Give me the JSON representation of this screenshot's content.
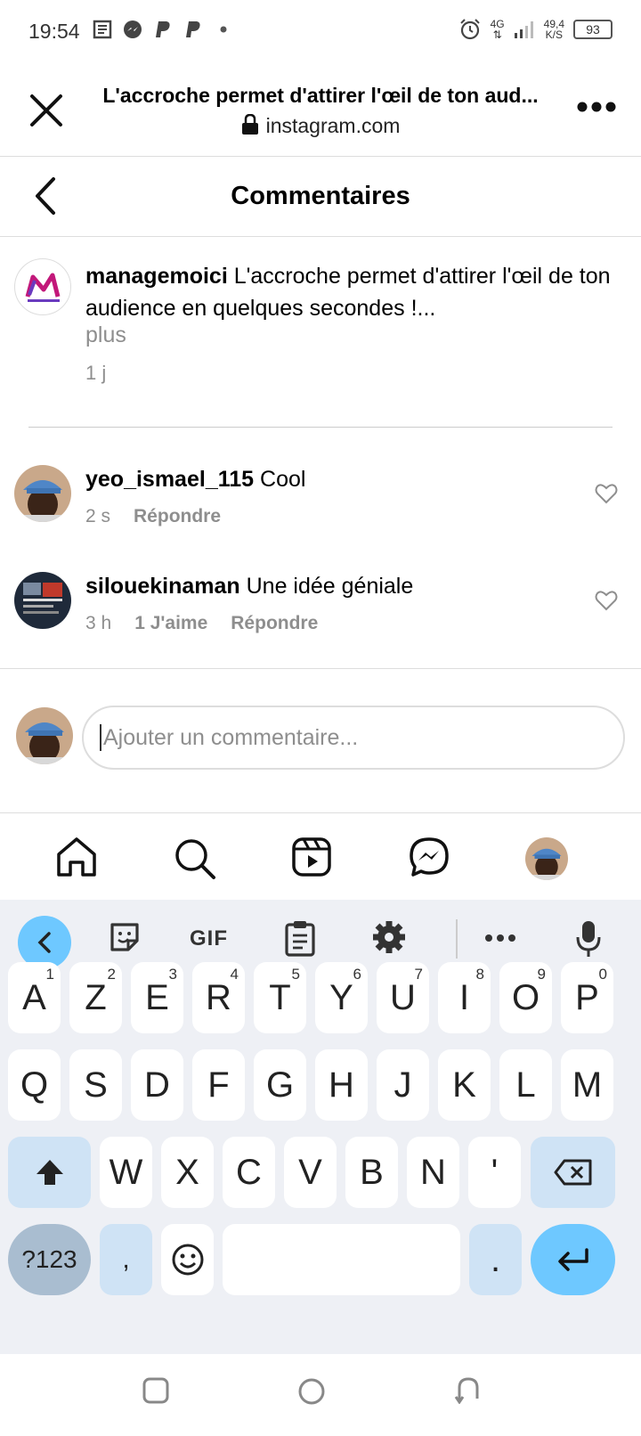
{
  "status_bar": {
    "time": "19:54",
    "network": "4G",
    "speed_value": "49,4",
    "speed_unit": "K/S",
    "battery": "93"
  },
  "browser": {
    "title": "L'accroche permet d'attirer l'œil de ton aud...",
    "url": "instagram.com"
  },
  "header": {
    "title": "Commentaires"
  },
  "caption": {
    "username": "managemoici",
    "text": " L'accroche permet d'attirer l'œil de ton audience en quelques secondes !...",
    "more": "plus",
    "time": "1 j"
  },
  "comments": [
    {
      "username": "yeo_ismael_115",
      "text": " Cool",
      "time": "2 s",
      "likes": "",
      "reply": "Répondre"
    },
    {
      "username": "silouekinaman",
      "text": " Une idée géniale",
      "time": "3 h",
      "likes": "1 J'aime",
      "reply": "Répondre"
    }
  ],
  "input": {
    "placeholder": "Ajouter un commentaire..."
  },
  "keyboard": {
    "toolbar": {
      "gif": "GIF"
    },
    "row1": [
      {
        "k": "A",
        "s": "1"
      },
      {
        "k": "Z",
        "s": "2"
      },
      {
        "k": "E",
        "s": "3"
      },
      {
        "k": "R",
        "s": "4"
      },
      {
        "k": "T",
        "s": "5"
      },
      {
        "k": "Y",
        "s": "6"
      },
      {
        "k": "U",
        "s": "7"
      },
      {
        "k": "I",
        "s": "8"
      },
      {
        "k": "O",
        "s": "9"
      },
      {
        "k": "P",
        "s": "0"
      }
    ],
    "row2": [
      "Q",
      "S",
      "D",
      "F",
      "G",
      "H",
      "J",
      "K",
      "L",
      "M"
    ],
    "row3": [
      "W",
      "X",
      "C",
      "V",
      "B",
      "N",
      "'"
    ],
    "sym": "?123",
    "comma": ",",
    "period": "."
  }
}
